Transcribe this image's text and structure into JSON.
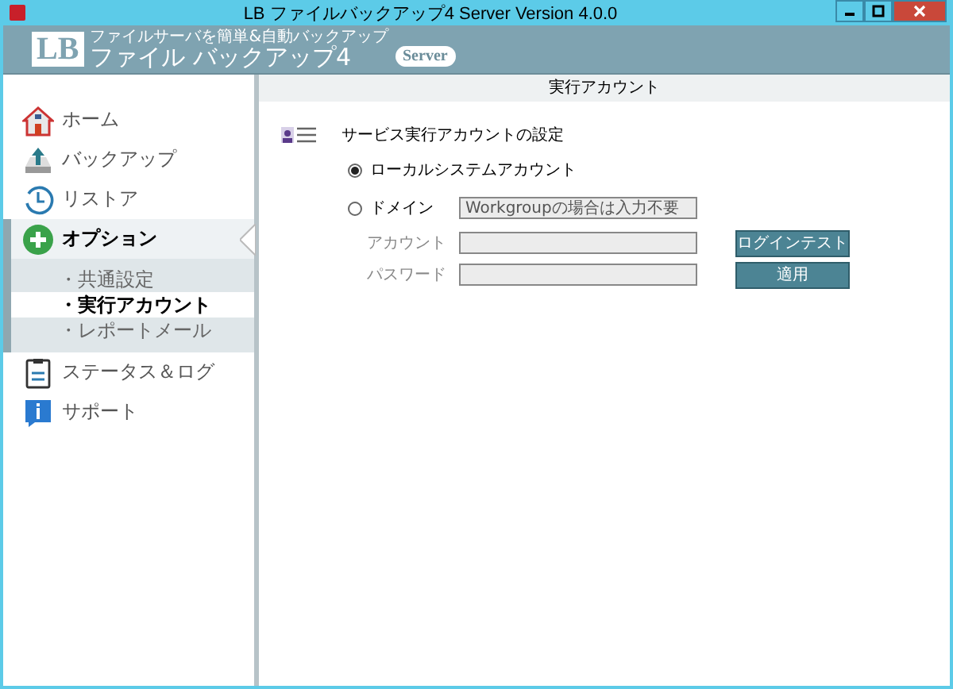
{
  "window": {
    "title": "LB ファイルバックアップ4 Server Version 4.0.0"
  },
  "brand": {
    "mark": "LB",
    "tagline": "ファイルサーバを簡単&自動バックアップ",
    "name": "ファイル バックアップ4",
    "edition": "Server"
  },
  "sidebar": {
    "items": [
      {
        "label": "ホーム",
        "selected": false
      },
      {
        "label": "バックアップ",
        "selected": false
      },
      {
        "label": "リストア",
        "selected": false
      },
      {
        "label": "オプション",
        "selected": true,
        "expanded": true,
        "children": [
          {
            "label": "・共通設定",
            "selected": false
          },
          {
            "label": "・実行アカウント",
            "selected": true
          },
          {
            "label": "・レポートメール",
            "selected": false
          }
        ]
      },
      {
        "label": "ステータス＆ログ",
        "selected": false
      },
      {
        "label": "サポート",
        "selected": false
      }
    ]
  },
  "page": {
    "title": "実行アカウント",
    "section": "サービス実行アカウントの設定",
    "options": [
      {
        "label": "ローカルシステムアカウント",
        "selected": true
      },
      {
        "label": "ドメイン",
        "selected": false
      }
    ],
    "domain_field": {
      "placeholder": "Workgroupの場合は入力不要",
      "disabled": true
    },
    "fields": [
      {
        "label": "アカウント",
        "disabled": true
      },
      {
        "label": "パスワード",
        "disabled": true
      }
    ],
    "buttons": [
      "ログインテスト",
      "適用"
    ]
  }
}
